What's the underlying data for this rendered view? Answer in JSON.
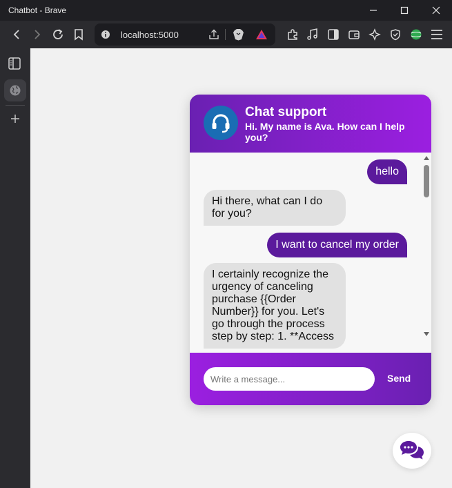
{
  "window": {
    "title": "Chatbot - Brave"
  },
  "browser": {
    "url": "localhost:5000"
  },
  "chat": {
    "header_title": "Chat support",
    "header_subtitle": "Hi. My name is Ava. How can I help you?",
    "messages": [
      {
        "role": "user",
        "text": "hello"
      },
      {
        "role": "bot",
        "text": "Hi there, what can I do for you?"
      },
      {
        "role": "user",
        "text": "I want to cancel my order"
      },
      {
        "role": "bot",
        "text": "I certainly recognize the urgency of canceling purchase {{Order Number}} for you. Let's go through the process step by step: 1. **Access"
      }
    ],
    "input_placeholder": "Write a message...",
    "send_label": "Send"
  },
  "colors": {
    "accent_purple": "#6a20b2",
    "accent_violet": "#9b1fe0",
    "user_bubble": "#5b1a9c",
    "bot_bubble": "#e1e1e1",
    "avatar_blue": "#1a6db4"
  },
  "icons": [
    "shield-icon",
    "headset-icon",
    "chat-bubbles-icon",
    "back-icon",
    "forward-icon",
    "reload-icon",
    "bookmark-icon",
    "info-icon",
    "share-icon",
    "brave-lion-icon",
    "rewards-triangle-icon",
    "extensions-icon",
    "music-icon",
    "sidebar-icon",
    "wallet-icon",
    "leo-ai-icon",
    "vpn-icon",
    "globe-icon",
    "menu-icon",
    "plus-icon"
  ]
}
